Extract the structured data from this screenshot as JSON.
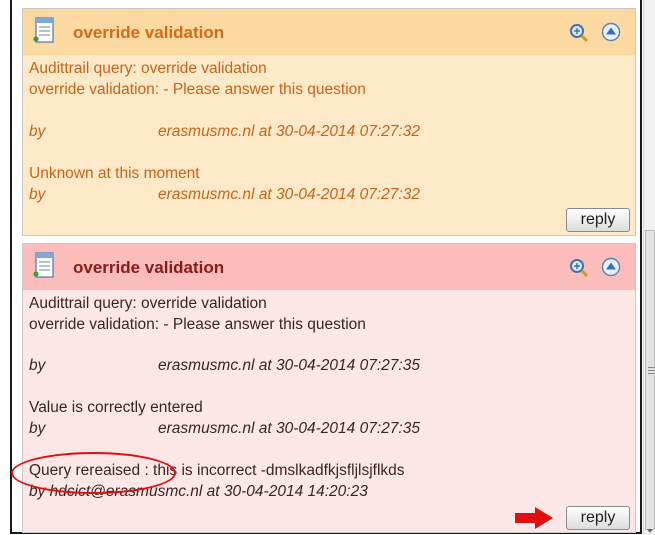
{
  "threads": [
    {
      "title": "override validation",
      "colors": {
        "header": "#fcd9a0",
        "body": "#fde9c8",
        "title": "#d46a1a",
        "text": "#c8641a"
      },
      "lines": [
        "Audittrail query: override validation",
        "override validation: - Please answer this question"
      ],
      "messages": [
        {
          "by": "by",
          "who": "erasmusmc.nl at 30-04-2014 07:27:32"
        },
        {
          "text": "Unknown at this moment",
          "by": "by",
          "who": "erasmusmc.nl at 30-04-2014 07:27:32"
        }
      ],
      "reply_label": "reply"
    },
    {
      "title": "override validation",
      "colors": {
        "header": "#fbbdbb",
        "body": "#fde6e6",
        "title": "#8b1a1a",
        "text": "#3a2424"
      },
      "lines": [
        "Audittrail query: override validation",
        "override validation: - Please answer this question"
      ],
      "messages": [
        {
          "by": "by",
          "who": "erasmusmc.nl at 30-04-2014 07:27:35"
        },
        {
          "text": "Value is correctly entered",
          "by": "by",
          "who": "erasmusmc.nl at 30-04-2014 07:27:35"
        },
        {
          "text": "Query rereaised : this is incorrect -dmslkadfkjsfljlsjflkds",
          "byline": "by hdcict@erasmusmc.nl at 30-04-2014 14:20:23"
        }
      ],
      "reply_label": "reply"
    }
  ],
  "icons": {
    "doc": "document-icon",
    "zoom": "zoom-icon",
    "collapse": "collapse-up-icon",
    "arrow": "red-arrow-icon"
  },
  "annotation_color": "#e01010"
}
